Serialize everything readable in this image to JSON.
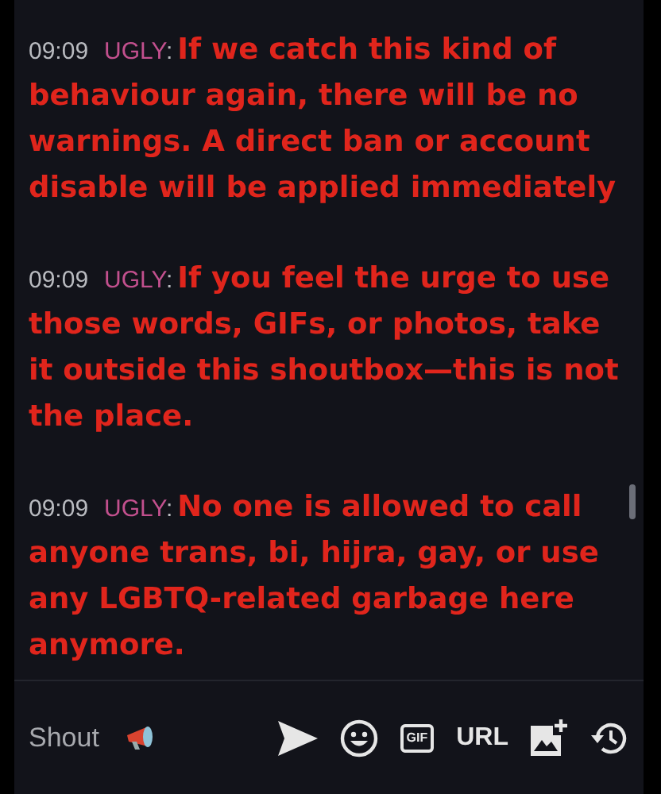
{
  "messages": [
    {
      "time": "09:09",
      "user": "UGLY",
      "separator": ":",
      "text": "If we catch this kind of behaviour again, there will be no warnings. A direct ban or account disable will be applied immediately"
    },
    {
      "time": "09:09",
      "user": "UGLY",
      "separator": ":",
      "text": "If you feel the urge to use those words, GIFs, or photos, take it outside this shoutbox—this is not the place."
    },
    {
      "time": "09:09",
      "user": "UGLY",
      "separator": ":",
      "text": "No one is allowed to call anyone trans, bi, hijra, gay, or use any LGBTQ-related garbage here anymore."
    }
  ],
  "composer": {
    "placeholder": "Shout",
    "gif_label": "GIF",
    "url_label": "URL"
  }
}
